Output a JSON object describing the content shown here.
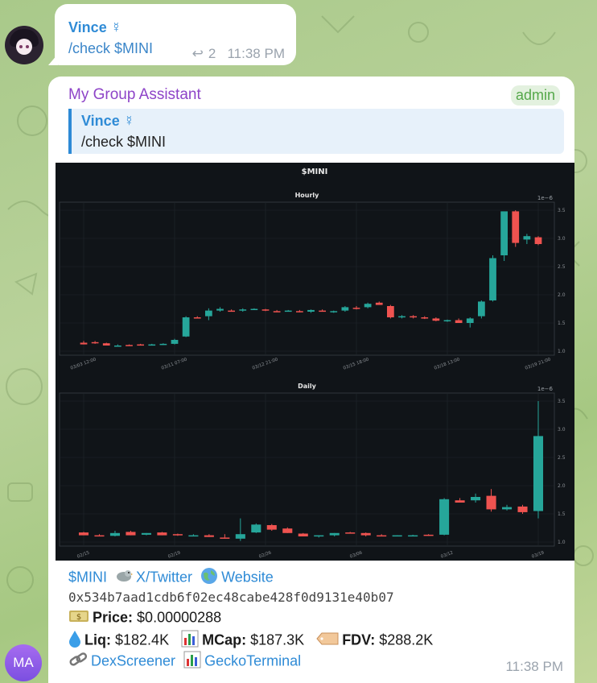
{
  "message1": {
    "sender": "Vince ☿",
    "text": "/check $MINI",
    "reply_count": "2",
    "time": "11:38 PM"
  },
  "message2": {
    "sender": "My Group Assistant",
    "badge": "admin",
    "quote": {
      "sender": "Vince ☿",
      "text": "/check $MINI"
    },
    "time": "11:38 PM",
    "info": {
      "token": "$MINI",
      "twitter_label": "X/Twitter",
      "website_label": "Website",
      "address": "0x534b7aad1cdb6f02ec48cabe428f0d9131e40b07",
      "price_label": "Price:",
      "price_value": "$0.00000288",
      "liq_label": "Liq:",
      "liq_value": "$182.4K",
      "mcap_label": "MCap:",
      "mcap_value": "$187.3K",
      "fdv_label": "FDV:",
      "fdv_value": "$288.2K",
      "dexscreener_label": "DexScreener",
      "geckoterminal_label": "GeckoTerminal"
    }
  },
  "bottom_avatar": "MA",
  "chart_data": {
    "type": "candlestick",
    "title": "$MINI",
    "colors": {
      "up": "#26a69a",
      "down": "#ef5350",
      "bg": "#101418"
    },
    "panels": [
      {
        "subtitle": "Hourly",
        "scale_label": "1e−6",
        "ylim": [
          1.0,
          3.5
        ],
        "yticks": [
          "1.0",
          "1.5",
          "2.0",
          "2.5",
          "3.0",
          "3.5"
        ],
        "xticks": [
          "03/03 12:00",
          "03/11 07:00",
          "03/12 21:00",
          "03/15 18:00",
          "03/18 13:00",
          "03/19 21:00"
        ],
        "candles": [
          [
            1.15,
            1.18,
            1.12,
            1.12
          ],
          [
            1.16,
            1.18,
            1.13,
            1.14
          ],
          [
            1.14,
            1.15,
            1.12,
            1.1
          ],
          [
            1.1,
            1.12,
            1.09,
            1.1
          ],
          [
            1.11,
            1.12,
            1.1,
            1.1
          ],
          [
            1.12,
            1.13,
            1.11,
            1.11
          ],
          [
            1.12,
            1.13,
            1.11,
            1.12
          ],
          [
            1.12,
            1.14,
            1.11,
            1.13
          ],
          [
            1.13,
            1.22,
            1.12,
            1.2
          ],
          [
            1.26,
            1.62,
            1.25,
            1.6
          ],
          [
            1.6,
            1.62,
            1.58,
            1.59
          ],
          [
            1.62,
            1.76,
            1.55,
            1.72
          ],
          [
            1.72,
            1.78,
            1.7,
            1.75
          ],
          [
            1.72,
            1.74,
            1.7,
            1.71
          ],
          [
            1.72,
            1.76,
            1.7,
            1.74
          ],
          [
            1.74,
            1.76,
            1.73,
            1.75
          ],
          [
            1.74,
            1.75,
            1.71,
            1.72
          ],
          [
            1.71,
            1.73,
            1.7,
            1.7
          ],
          [
            1.71,
            1.73,
            1.7,
            1.72
          ],
          [
            1.71,
            1.73,
            1.69,
            1.7
          ],
          [
            1.7,
            1.74,
            1.68,
            1.73
          ],
          [
            1.72,
            1.74,
            1.7,
            1.71
          ],
          [
            1.69,
            1.72,
            1.68,
            1.71
          ],
          [
            1.72,
            1.8,
            1.7,
            1.78
          ],
          [
            1.77,
            1.8,
            1.74,
            1.76
          ],
          [
            1.78,
            1.86,
            1.76,
            1.84
          ],
          [
            1.86,
            1.88,
            1.83,
            1.82
          ],
          [
            1.8,
            1.82,
            1.58,
            1.6
          ],
          [
            1.6,
            1.64,
            1.58,
            1.62
          ],
          [
            1.62,
            1.64,
            1.58,
            1.61
          ],
          [
            1.6,
            1.62,
            1.57,
            1.58
          ],
          [
            1.58,
            1.6,
            1.53,
            1.54
          ],
          [
            1.54,
            1.56,
            1.52,
            1.55
          ],
          [
            1.55,
            1.58,
            1.5,
            1.5
          ],
          [
            1.5,
            1.6,
            1.42,
            1.58
          ],
          [
            1.62,
            1.9,
            1.58,
            1.88
          ],
          [
            1.9,
            2.7,
            1.88,
            2.65
          ],
          [
            2.7,
            3.45,
            2.6,
            3.48
          ],
          [
            3.48,
            3.5,
            2.85,
            2.92
          ],
          [
            2.98,
            3.08,
            2.9,
            3.04
          ],
          [
            3.02,
            3.04,
            2.88,
            2.9
          ]
        ]
      },
      {
        "subtitle": "Daily",
        "scale_label": "1e−6",
        "ylim": [
          1.0,
          3.5
        ],
        "yticks": [
          "1.0",
          "1.5",
          "2.0",
          "2.5",
          "3.0",
          "3.5"
        ],
        "xticks": [
          "02/15",
          "02/19",
          "02/26",
          "03/06",
          "03/12",
          "03/19"
        ],
        "candles": [
          [
            1.17,
            1.18,
            1.12,
            1.12
          ],
          [
            1.12,
            1.14,
            1.1,
            1.1
          ],
          [
            1.11,
            1.2,
            1.1,
            1.16
          ],
          [
            1.18,
            1.2,
            1.12,
            1.12
          ],
          [
            1.13,
            1.16,
            1.12,
            1.16
          ],
          [
            1.17,
            1.18,
            1.12,
            1.12
          ],
          [
            1.14,
            1.15,
            1.11,
            1.12
          ],
          [
            1.12,
            1.14,
            1.11,
            1.12
          ],
          [
            1.12,
            1.14,
            1.09,
            1.09
          ],
          [
            1.08,
            1.14,
            1.06,
            1.06
          ],
          [
            1.06,
            1.42,
            1.02,
            1.14
          ],
          [
            1.17,
            1.33,
            1.16,
            1.31
          ],
          [
            1.3,
            1.32,
            1.2,
            1.22
          ],
          [
            1.24,
            1.26,
            1.16,
            1.16
          ],
          [
            1.15,
            1.16,
            1.1,
            1.1
          ],
          [
            1.1,
            1.12,
            1.08,
            1.12
          ],
          [
            1.12,
            1.16,
            1.1,
            1.16
          ],
          [
            1.17,
            1.18,
            1.15,
            1.16
          ],
          [
            1.16,
            1.17,
            1.1,
            1.12
          ],
          [
            1.12,
            1.14,
            1.1,
            1.11
          ],
          [
            1.11,
            1.12,
            1.1,
            1.12
          ],
          [
            1.12,
            1.13,
            1.1,
            1.12
          ],
          [
            1.13,
            1.14,
            1.11,
            1.12
          ],
          [
            1.13,
            1.78,
            1.12,
            1.76
          ],
          [
            1.74,
            1.78,
            1.7,
            1.7
          ],
          [
            1.74,
            1.86,
            1.7,
            1.8
          ],
          [
            1.82,
            1.94,
            1.54,
            1.58
          ],
          [
            1.58,
            1.66,
            1.56,
            1.62
          ],
          [
            1.63,
            1.66,
            1.5,
            1.53
          ],
          [
            1.55,
            3.5,
            1.42,
            2.88
          ]
        ]
      }
    ]
  }
}
